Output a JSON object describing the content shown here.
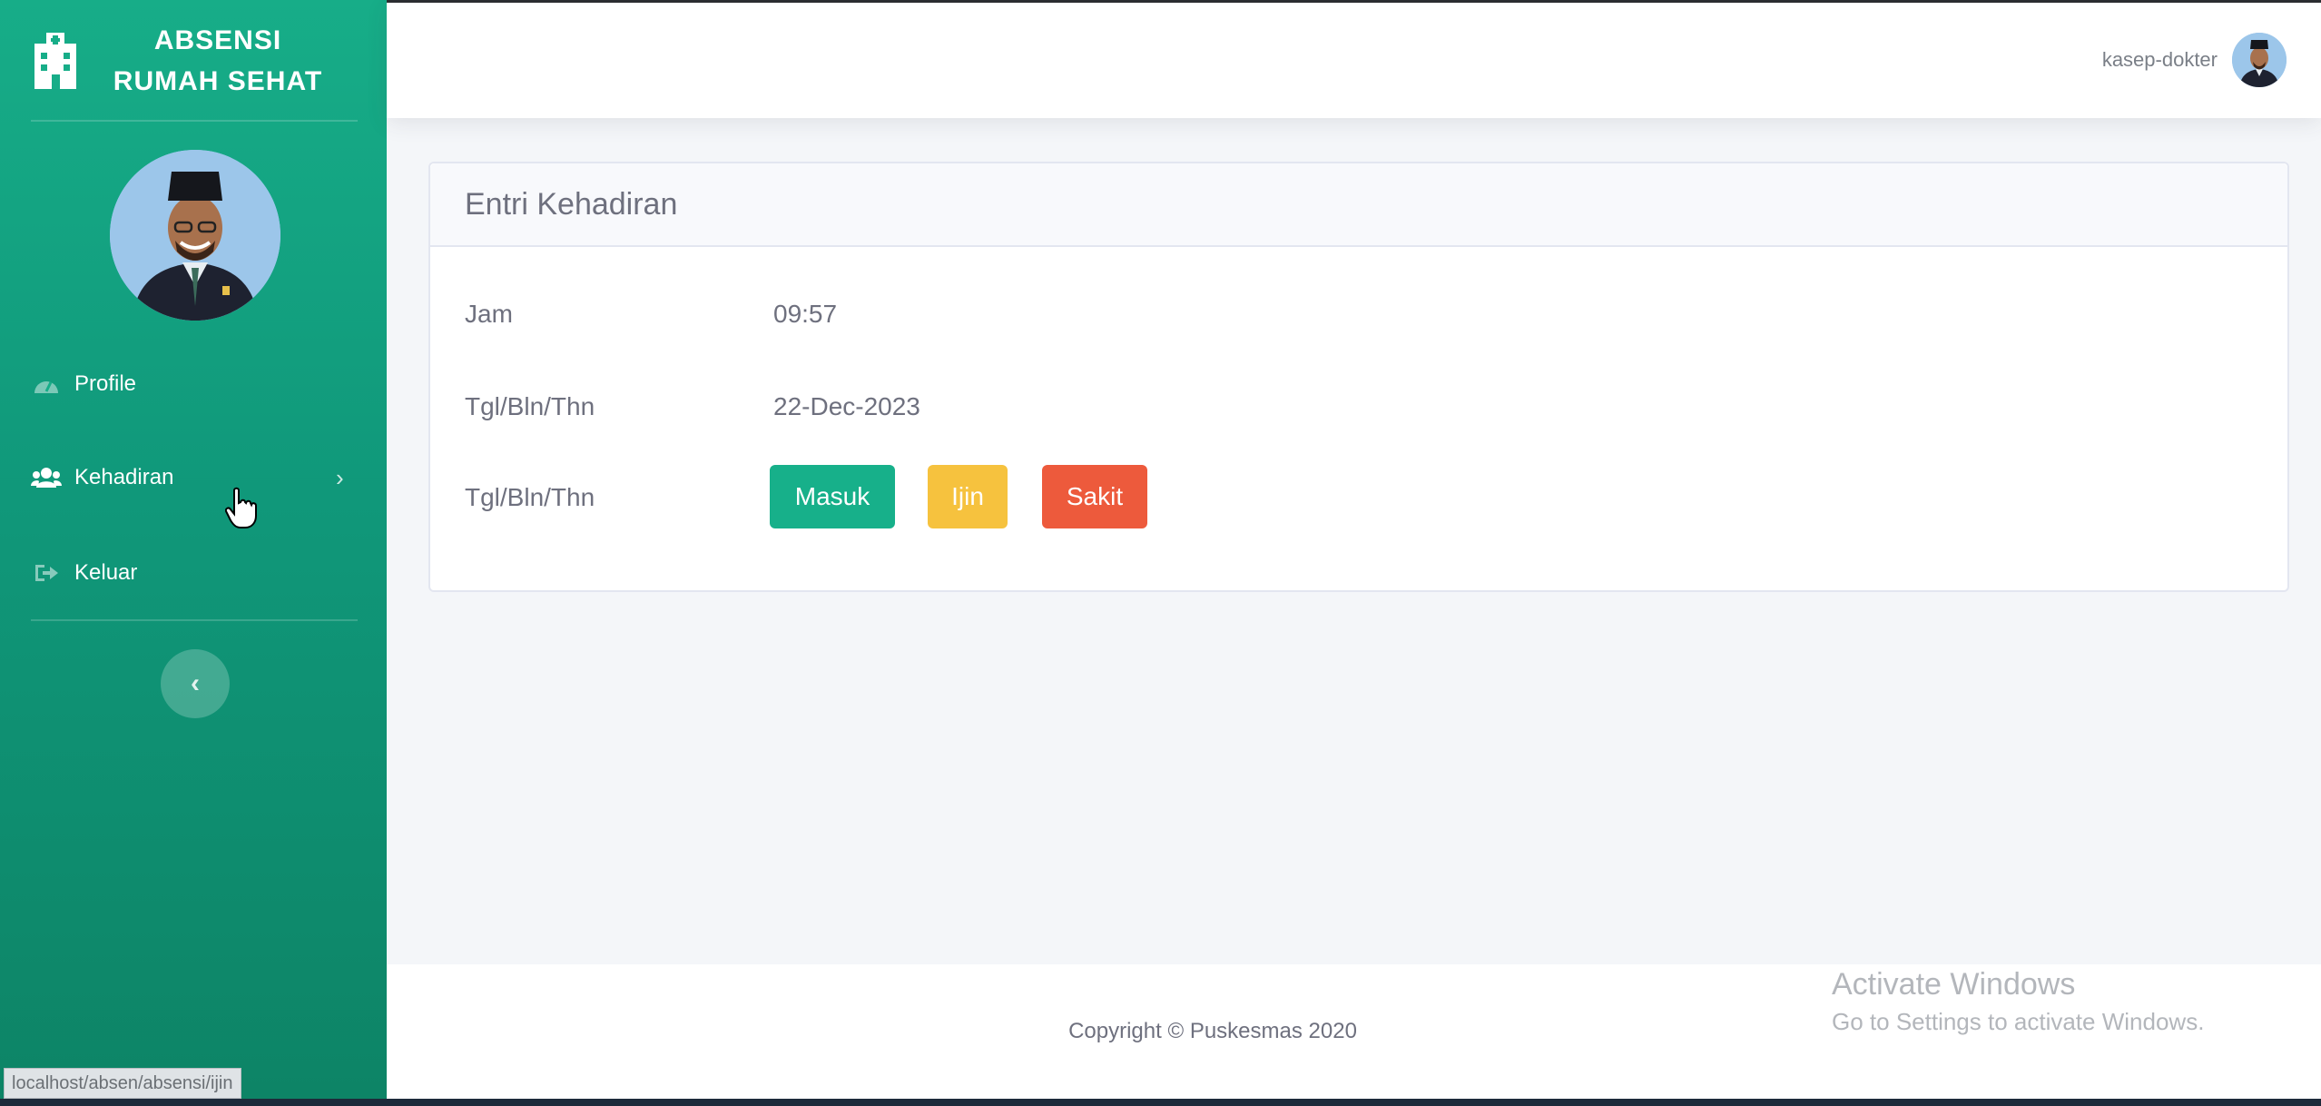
{
  "sidebar": {
    "brand_line1": "ABSENSI",
    "brand_line2": "RUMAH SEHAT",
    "brand_icon": "hospital-icon",
    "items": [
      {
        "label": "Profile",
        "icon": "tachometer-icon"
      },
      {
        "label": "Kehadiran",
        "icon": "users-icon",
        "chevron": "›"
      },
      {
        "label": "Keluar",
        "icon": "sign-out-icon"
      }
    ],
    "toggle_label": "‹"
  },
  "topbar": {
    "user_name": "kasep-dokter"
  },
  "card": {
    "title": "Entri Kehadiran",
    "rows": [
      {
        "label": "Jam",
        "value": "09:57"
      },
      {
        "label": "Tgl/Bln/Thn",
        "value": "22-Dec-2023"
      },
      {
        "label": "Tgl/Bln/Thn"
      }
    ],
    "buttons": {
      "masuk": "Masuk",
      "ijin": "Ijin",
      "sakit": "Sakit"
    }
  },
  "footer": {
    "copyright": "Copyright © Puskesmas 2020"
  },
  "overlay": {
    "activate_title": "Activate Windows",
    "activate_sub": "Go to Settings to activate Windows."
  },
  "status_bar": {
    "url": "localhost/absen/absensi/ijin"
  },
  "colors": {
    "sidebar": "#17ad88",
    "masuk": "#17b08a",
    "ijin": "#f6c23e",
    "sakit": "#ed5a3c"
  }
}
